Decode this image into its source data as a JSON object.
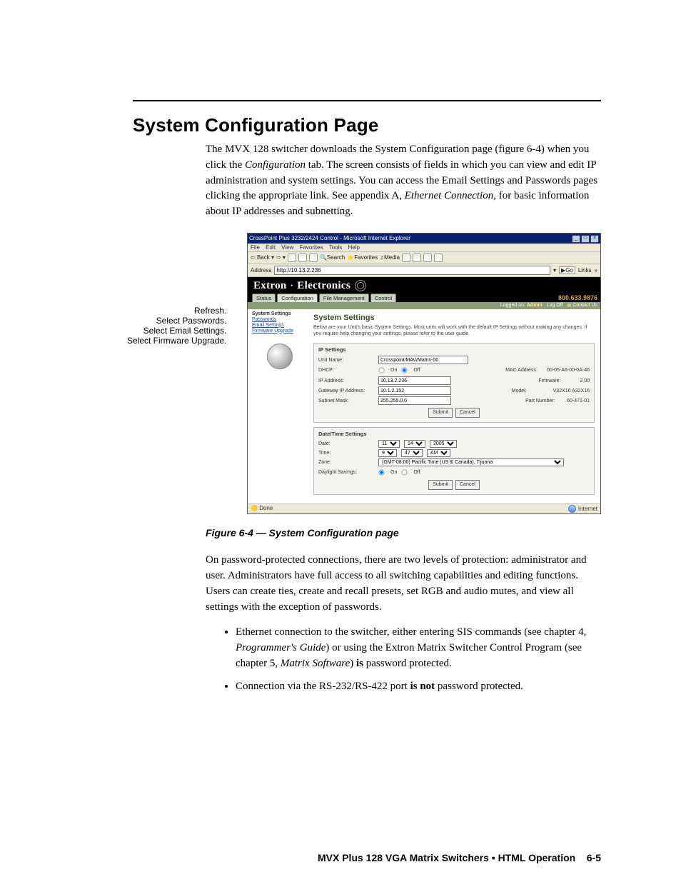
{
  "heading": "System Configuration Page",
  "intro_part1": "The MVX 128 switcher downloads the System Configuration page (figure 6-4) when you click the ",
  "intro_em1": "Configuration",
  "intro_part2": " tab.  The screen consists of fields in which you can view and edit IP administration and system settings.  You can access the Email Settings and Passwords pages clicking the appropriate link.  See appendix A, ",
  "intro_em2": "Ethernet Connection",
  "intro_part3": ", for basic information about IP addresses and subnetting.",
  "callouts": {
    "a": "Refresh.",
    "b": "Select Passwords.",
    "c": "Select Email Settings.",
    "d": "Select Firmware Upgrade."
  },
  "browser": {
    "title": "CrossPoint Plus 3232/2424 Control - Microsoft Internet Explorer",
    "menus": [
      "File",
      "Edit",
      "View",
      "Favorites",
      "Tools",
      "Help"
    ],
    "toolbtns": {
      "back": "Back",
      "search": "Search",
      "favorites": "Favorites",
      "media": "Media"
    },
    "address_label": "Address",
    "address_value": "http://10.13.2.236",
    "go": "Go",
    "links": "Links",
    "status_done": "Done",
    "status_net": "Internet"
  },
  "brand": {
    "name": "Extron",
    "sub": "Electronics"
  },
  "phone": "800.633.9876",
  "tabs": [
    "Status",
    "Configuration",
    "File Management",
    "Control"
  ],
  "session": {
    "label": "Logged on:",
    "user": "Admin",
    "logoff": "Log Off",
    "contact": "Contact Us"
  },
  "sidebar": {
    "items": [
      "System Settings",
      "Passwords",
      "Email Settings",
      "Firmware Upgrade"
    ]
  },
  "main": {
    "title": "System Settings",
    "desc": "Below are your Unit's basic System Settings. Most units will work with the default IP Settings without making any changes. If you require help changing your settings, please refer to the user guide.",
    "ip": {
      "heading": "IP Settings",
      "unit_label": "Unit Name:",
      "unit_value": "Crosspoint/MAV/Matrix-00",
      "dhcp_label": "DHCP:",
      "on": "On",
      "off": "Off",
      "ip_label": "IP Address:",
      "ip_value": "10.13.2.236",
      "gw_label": "Gateway IP Address:",
      "gw_value": "10.1.2.152",
      "mask_label": "Subnet Mask:",
      "mask_value": "255.255.0.0",
      "mac_label": "MAC Address:",
      "mac_value": "00-05-A6-00-0A-46",
      "fw_label": "Firmware:",
      "fw_value": "2.00",
      "model_label": "Model:",
      "model_value": "V32X16 A32X16",
      "pn_label": "Part Number:",
      "pn_value": "60-471-01",
      "submit": "Submit",
      "cancel": "Cancel"
    },
    "dt": {
      "heading": "Date/Time Settings",
      "date_label": "Date:",
      "month": "11",
      "day": "14",
      "year": "2005",
      "time_label": "Time:",
      "hh": "9",
      "mm": "47",
      "ampm": "AM",
      "zone_label": "Zone:",
      "zone_value": "(GMT-08:00) Pacific Time (US & Canada), Tijuana",
      "ds_label": "Daylight Savings:",
      "on": "On",
      "off": "Off",
      "submit": "Submit",
      "cancel": "Cancel"
    }
  },
  "figcaption": "Figure 6-4 — System Configuration page",
  "para2": "On password-protected connections, there are two levels of protection: administrator and user.  Administrators have full access to all switching capabilities and editing functions.  Users can create ties, create and recall presets, set RGB and audio mutes, and view all settings with the exception of passwords.",
  "bullets": {
    "b1a": "Ethernet connection to the switcher, either entering SIS commands (see chapter 4, ",
    "b1em1": "Programmer's Guide",
    "b1b": ") or using the Extron Matrix Switcher Control Program (see chapter 5, ",
    "b1em2": "Matrix Software",
    "b1c": ") ",
    "b1bold": "is",
    "b1d": " password protected.",
    "b2a": "Connection via the RS-232/RS-422 port ",
    "b2bold": "is not",
    "b2b": " password protected."
  },
  "footer": {
    "product": "MVX Plus 128 VGA Matrix Switchers • HTML Operation",
    "pg": "6-5"
  }
}
